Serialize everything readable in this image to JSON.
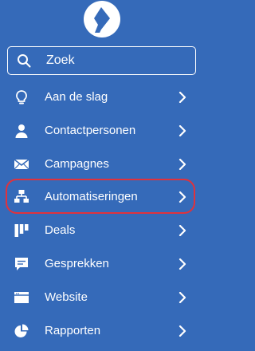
{
  "app": {
    "logo_icon": "pipedrive-style-logo-icon"
  },
  "search": {
    "placeholder": "Zoek",
    "icon": "search-icon"
  },
  "nav": {
    "items": [
      {
        "label": "Aan de slag",
        "icon": "lightbulb-icon"
      },
      {
        "label": "Contactpersonen",
        "icon": "person-icon"
      },
      {
        "label": "Campagnes",
        "icon": "envelope-icon"
      },
      {
        "label": "Automatiseringen",
        "icon": "workflow-icon",
        "highlighted": true
      },
      {
        "label": "Deals",
        "icon": "pipeline-icon"
      },
      {
        "label": "Gesprekken",
        "icon": "chat-icon"
      },
      {
        "label": "Website",
        "icon": "browser-icon"
      },
      {
        "label": "Rapporten",
        "icon": "pie-chart-icon"
      }
    ]
  },
  "colors": {
    "background": "#356ab9",
    "foreground": "#ffffff",
    "highlight": "#e0323c"
  }
}
